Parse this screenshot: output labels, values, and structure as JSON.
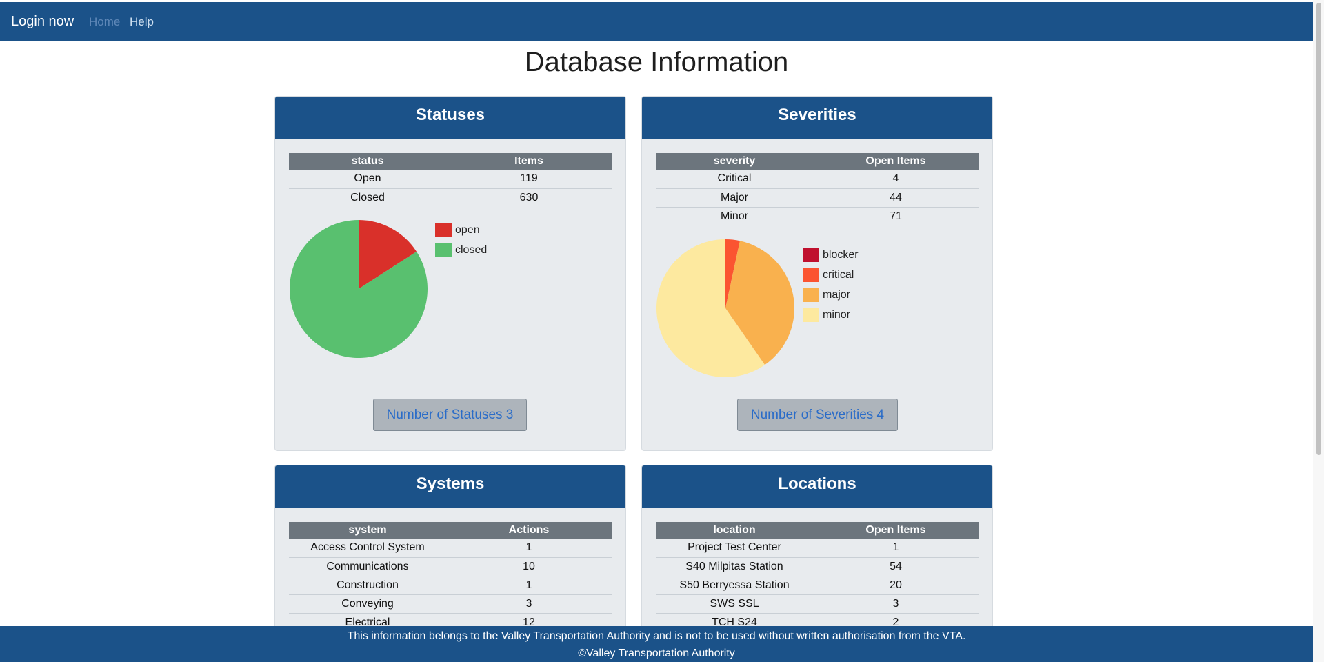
{
  "nav": {
    "brand": "Login now",
    "home": "Home",
    "help": "Help"
  },
  "page_title": "Database Information",
  "statuses": {
    "title": "Statuses",
    "columns": [
      "status",
      "Items"
    ],
    "rows": [
      [
        "Open",
        "119"
      ],
      [
        "Closed",
        "630"
      ]
    ],
    "legend": [
      "open",
      "closed"
    ],
    "button": "Number of Statuses 3"
  },
  "severities": {
    "title": "Severities",
    "columns": [
      "severity",
      "Open Items"
    ],
    "rows": [
      [
        "Critical",
        "4"
      ],
      [
        "Major",
        "44"
      ],
      [
        "Minor",
        "71"
      ]
    ],
    "legend": [
      "blocker",
      "critical",
      "major",
      "minor"
    ],
    "button": "Number of Severities 4"
  },
  "systems": {
    "title": "Systems",
    "columns": [
      "system",
      "Actions"
    ],
    "rows": [
      [
        "Access Control System",
        "1"
      ],
      [
        "Communications",
        "10"
      ],
      [
        "Construction",
        "1"
      ],
      [
        "Conveying",
        "3"
      ],
      [
        "Electrical",
        "12"
      ]
    ]
  },
  "locations": {
    "title": "Locations",
    "columns": [
      "location",
      "Open Items"
    ],
    "rows": [
      [
        "Project Test Center",
        "1"
      ],
      [
        "S40 Milpitas Station",
        "54"
      ],
      [
        "S50 Berryessa Station",
        "20"
      ],
      [
        "SWS SSL",
        "3"
      ],
      [
        "TCH S24",
        "2"
      ]
    ]
  },
  "footer": {
    "line1": "This information belongs to the Valley Transportation Authority and is not to be used without written authorisation from the VTA.",
    "line2": "©Valley Transportation Authority"
  },
  "chart_data": [
    {
      "type": "pie",
      "labels": [
        "open",
        "closed"
      ],
      "values": [
        119,
        630
      ],
      "colors": [
        "#d9302a",
        "#59c06f"
      ]
    },
    {
      "type": "pie",
      "labels": [
        "blocker",
        "critical",
        "major",
        "minor"
      ],
      "values": [
        0,
        4,
        44,
        71
      ],
      "colors": [
        "#c0102e",
        "#fb5431",
        "#f9b14e",
        "#fde99f"
      ]
    }
  ]
}
